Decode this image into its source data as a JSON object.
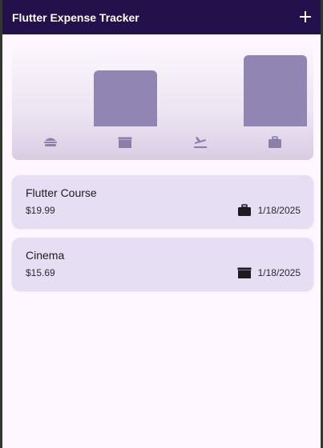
{
  "app_bar": {
    "title": "Flutter Expense Tracker",
    "add_icon": "plus-icon"
  },
  "chart_data": {
    "type": "bar",
    "categories": [
      "food",
      "leisure",
      "travel",
      "work"
    ],
    "values": [
      0,
      15.69,
      0,
      19.99
    ],
    "icons": [
      "burger-icon",
      "movie-icon",
      "airplane-icon",
      "briefcase-icon"
    ],
    "colors": {
      "bar": "#9185b3",
      "icon": "#8a7fa8"
    }
  },
  "expenses": [
    {
      "title": "Flutter Course",
      "amount": "$19.99",
      "date": "1/18/2025",
      "category_icon": "briefcase-icon"
    },
    {
      "title": "Cinema",
      "amount": "$15.69",
      "date": "1/18/2025",
      "category_icon": "movie-icon"
    }
  ]
}
